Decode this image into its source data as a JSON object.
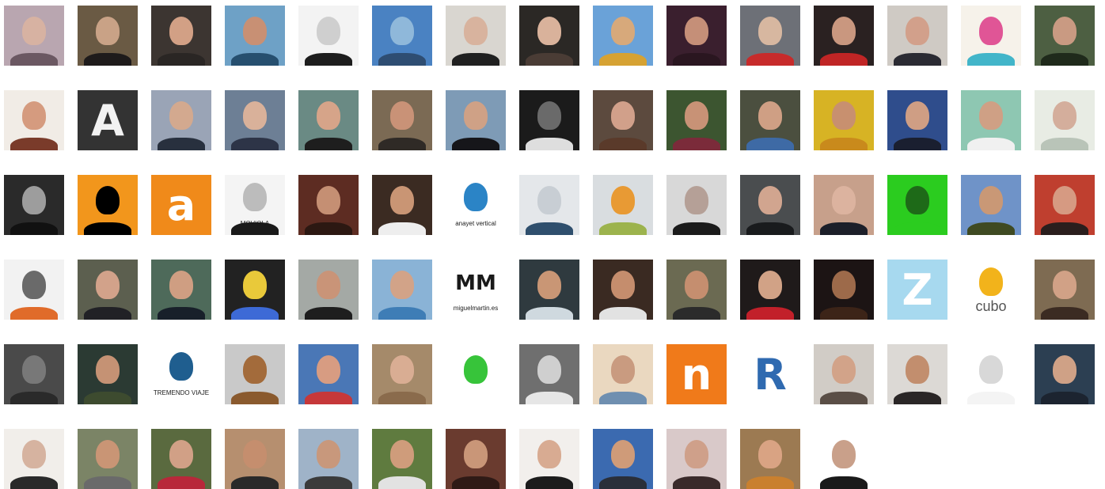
{
  "wall": {
    "rows": [
      {
        "items": [
          {
            "name": "woman-portrait",
            "bg": "#b9a6b0",
            "face": "#d7b2a2",
            "body": "#6b5862"
          },
          {
            "name": "man-glasses-portrait",
            "bg": "#6a5a44",
            "face": "#c9a286",
            "body": "#1e1b1b"
          },
          {
            "name": "smiling-man-portrait",
            "bg": "#3c3531",
            "face": "#d2a085",
            "body": "#2a2624"
          },
          {
            "name": "woman-sea-portrait",
            "bg": "#6ea1c6",
            "face": "#c89074",
            "body": "#264f6f"
          },
          {
            "name": "pixel-building-logo",
            "bg": "#f3f3f3",
            "face": "#cfcfcf",
            "body": "#1d1d1d"
          },
          {
            "name": "skyscraper-photo",
            "bg": "#4a82c2",
            "face": "#8fb8da",
            "body": "#2e4d72"
          },
          {
            "name": "bald-man-glasses-portrait",
            "bg": "#d9d6d0",
            "face": "#d8b39e",
            "body": "#202020"
          },
          {
            "name": "woman-glasses-portrait",
            "bg": "#2b2825",
            "face": "#d9b29b",
            "body": "#4a3c35"
          },
          {
            "name": "man-field-photo",
            "bg": "#6aa2d8",
            "face": "#d7a97b",
            "body": "#d6a233"
          },
          {
            "name": "woman-dark-portrait",
            "bg": "#3a1f2e",
            "face": "#c58f78",
            "body": "#2a1620"
          },
          {
            "name": "man-red-shirt-portrait",
            "bg": "#6d7077",
            "face": "#d7b7a0",
            "body": "#c72b2b"
          },
          {
            "name": "man-hat-cards-portrait",
            "bg": "#2a2121",
            "face": "#c9977f",
            "body": "#c02525"
          },
          {
            "name": "man-suit-tie-portrait",
            "bg": "#cfcac4",
            "face": "#d2a08b",
            "body": "#2b2b33"
          },
          {
            "name": "colorful-circle-logo",
            "bg": "#f6f2ea",
            "face": "#e05596",
            "body": "#42b5c9"
          },
          {
            "name": "man-outdoor-portrait",
            "bg": "#4d5f42",
            "face": "#c99a82",
            "body": "#1f2a1b"
          }
        ]
      },
      {
        "items": [
          {
            "name": "woman-red-hair-portrait",
            "bg": "#f1ece6",
            "face": "#d59b7f",
            "body": "#7a3b2a"
          },
          {
            "name": "letter-a-logo",
            "bg": "#333333",
            "face": "#555555",
            "body": "#222222",
            "glyph": "A",
            "glyphColor": "#f2f2f2"
          },
          {
            "name": "man-thinking-portrait",
            "bg": "#9aa4b6",
            "face": "#d3a98f",
            "body": "#28303e"
          },
          {
            "name": "man-suit-glasses-portrait",
            "bg": "#6d7f95",
            "face": "#d9b19a",
            "body": "#2d3447"
          },
          {
            "name": "woman-dark-hair-portrait",
            "bg": "#6a8a84",
            "face": "#d6a489",
            "body": "#1e1e1e"
          },
          {
            "name": "woman-smiling-portrait",
            "bg": "#7b6a54",
            "face": "#c99277",
            "body": "#2f2a26"
          },
          {
            "name": "man-poster-portrait",
            "bg": "#7e9bb6",
            "face": "#cfa186",
            "body": "#16161a"
          },
          {
            "name": "pixel-dark-logo",
            "bg": "#1b1b1b",
            "face": "#6a6a6a",
            "body": "#dedede"
          },
          {
            "name": "woman-curly-hair-portrait",
            "bg": "#5c4a3e",
            "face": "#d1a08a",
            "body": "#5a3a2a"
          },
          {
            "name": "woman-laughing-portrait",
            "bg": "#3c5530",
            "face": "#c89276",
            "body": "#7b2b3a"
          },
          {
            "name": "man-blue-shirt-portrait",
            "bg": "#4b4f3f",
            "face": "#cf9f84",
            "body": "#3e6aa5"
          },
          {
            "name": "man-yellow-bg-portrait",
            "bg": "#d7b324",
            "face": "#c8906f",
            "body": "#c98a1c"
          },
          {
            "name": "man-blue-stage-portrait",
            "bg": "#2f4d8c",
            "face": "#cf9e84",
            "body": "#1a1f30"
          },
          {
            "name": "man-green-bg-portrait",
            "bg": "#8ec7b2",
            "face": "#cfa085",
            "body": "#f0f0f0"
          },
          {
            "name": "woman-pale-portrait",
            "bg": "#e8ece4",
            "face": "#d4ae9c",
            "body": "#b9c4b8"
          }
        ]
      },
      {
        "items": [
          {
            "name": "bearded-man-stone-portrait",
            "bg": "#2a2a2a",
            "face": "#9d9d9d",
            "body": "#111111"
          },
          {
            "name": "orange-torn-logo",
            "bg": "#f2961c",
            "face": "#000000",
            "body": "#000000"
          },
          {
            "name": "letter-a-orange-logo",
            "bg": "#f08a1a",
            "face": "#f2e7d8",
            "body": "#23303e",
            "glyph": "a",
            "glyphColor": "#ffffff"
          },
          {
            "name": "moviola-logo",
            "bg": "#f4f4f4",
            "face": "#bcbcbc",
            "body": "#1a1a1a",
            "caption": "MOVIOLA"
          },
          {
            "name": "man-long-hair-portrait",
            "bg": "#5d2c22",
            "face": "#c58f73",
            "body": "#2c1812"
          },
          {
            "name": "man-white-shirt-portrait",
            "bg": "#3b2b22",
            "face": "#c99574",
            "body": "#eeeeee"
          },
          {
            "name": "mountain-logo",
            "bg": "#ffffff",
            "face": "#2b84c6",
            "body": "#ffffff",
            "caption": "anayet vertical"
          },
          {
            "name": "signature-card-photo",
            "bg": "#e4e7ea",
            "face": "#c8ced4",
            "body": "#2f4f6d"
          },
          {
            "name": "fruit-photo",
            "bg": "#d9dde0",
            "face": "#e89a34",
            "body": "#9cb34d"
          },
          {
            "name": "bald-man-sunglasses-portrait",
            "bg": "#d8d8d8",
            "face": "#b5a097",
            "body": "#1b1b1b"
          },
          {
            "name": "man-black-jacket-portrait",
            "bg": "#4a4d4f",
            "face": "#d1a58f",
            "body": "#191b1d"
          },
          {
            "name": "blonde-woman-portrait",
            "bg": "#c7a08b",
            "face": "#dcb39f",
            "body": "#1c1f29"
          },
          {
            "name": "green-figure-logo",
            "bg": "#2bcc1f",
            "face": "#1e6a18",
            "body": "#2bcc1f"
          },
          {
            "name": "man-bald-outdoor-portrait",
            "bg": "#6f93c8",
            "face": "#c99876",
            "body": "#3f4a22"
          },
          {
            "name": "woman-smile-portrait",
            "bg": "#bf3f2f",
            "face": "#d69a82",
            "body": "#2a1e1d"
          }
        ]
      },
      {
        "items": [
          {
            "name": "man-fedora-logo",
            "bg": "#f2f2f2",
            "face": "#6a6a6a",
            "body": "#e06b2a"
          },
          {
            "name": "woman-earrings-portrait",
            "bg": "#5c5f4f",
            "face": "#d2a28a",
            "body": "#212126"
          },
          {
            "name": "man-profile-portrait",
            "bg": "#4e6a5a",
            "face": "#cf9e82",
            "body": "#18202a"
          },
          {
            "name": "test-card-logo",
            "bg": "#222222",
            "face": "#e9c93a",
            "body": "#3d6ad6"
          },
          {
            "name": "man-black-shirt-portrait",
            "bg": "#a4a9a5",
            "face": "#c99478",
            "body": "#1e1e1e"
          },
          {
            "name": "bald-man-blue-shirt-portrait",
            "bg": "#8ab3d6",
            "face": "#d2a388",
            "body": "#3e7db6"
          },
          {
            "name": "miguel-martin-logo",
            "bg": "#ffffff",
            "face": "#ffffff",
            "body": "#ffffff",
            "glyph": "MM",
            "glyphColor": "#1a1a1a",
            "caption": "miguelmartin.es"
          },
          {
            "name": "man-t-shirt-portrait",
            "bg": "#2f3a3f",
            "face": "#c99675",
            "body": "#cfd9df"
          },
          {
            "name": "man-white-shirt-night-portrait",
            "bg": "#3a2a22",
            "face": "#c58d6d",
            "body": "#e2e2e2"
          },
          {
            "name": "man-cap-portrait",
            "bg": "#6b6a52",
            "face": "#c58e6f",
            "body": "#2b2b2b"
          },
          {
            "name": "man-sunglasses-red-portrait",
            "bg": "#1f1a1a",
            "face": "#d1a286",
            "body": "#c2202a"
          },
          {
            "name": "man-aviator-portrait",
            "bg": "#1c1414",
            "face": "#9d6a4a",
            "body": "#3c2418"
          },
          {
            "name": "letter-z-logo",
            "bg": "#a7d9ef",
            "face": "#ffffff",
            "body": "#a7d9ef",
            "glyph": "Z",
            "glyphColor": "#ffffff"
          },
          {
            "name": "cubo-logo",
            "bg": "#ffffff",
            "face": "#f2b31b",
            "body": "#ffffff",
            "caption": "cubo"
          },
          {
            "name": "woman-brown-hair-portrait",
            "bg": "#7e6b52",
            "face": "#d1a186",
            "body": "#3b2b22"
          }
        ]
      },
      {
        "items": [
          {
            "name": "pixel-stripes-logo",
            "bg": "#4a4a4a",
            "face": "#787878",
            "body": "#2a2a2a"
          },
          {
            "name": "bearded-man-sign-portrait",
            "bg": "#2b3a33",
            "face": "#c59274",
            "body": "#3d4b2f"
          },
          {
            "name": "tremendo-viaje-logo",
            "bg": "#ffffff",
            "face": "#1f5e8f",
            "body": "#ffffff",
            "caption": "TREMENDO VIAJE"
          },
          {
            "name": "wookiee-toy-photo",
            "bg": "#c9c9c9",
            "face": "#a36b3b",
            "body": "#8a5a2e"
          },
          {
            "name": "woman-hat-sunglasses-portrait",
            "bg": "#4a77b6",
            "face": "#d79c82",
            "body": "#c6383a"
          },
          {
            "name": "blonde-woman-hand-portrait",
            "bg": "#a58a6a",
            "face": "#d9ad93",
            "body": "#8a6b4c"
          },
          {
            "name": "green-circle-logo",
            "bg": "#ffffff",
            "face": "#37c43a",
            "body": "#ffffff"
          },
          {
            "name": "child-bw-photo",
            "bg": "#6f6f6f",
            "face": "#cfcfcf",
            "body": "#e6e6e6"
          },
          {
            "name": "man-framed-photo",
            "bg": "#ead8c0",
            "face": "#c99b80",
            "body": "#6f8fb0"
          },
          {
            "name": "letter-n-orange-logo",
            "bg": "#f07a1a",
            "face": "#ffffff",
            "body": "#f07a1a",
            "glyph": "n",
            "glyphColor": "#ffffff"
          },
          {
            "name": "letter-r-blue-logo",
            "bg": "#ffffff",
            "face": "#2f6ab0",
            "body": "#ffffff",
            "glyph": "R",
            "glyphColor": "#2f6ab0"
          },
          {
            "name": "man-white-beard-portrait",
            "bg": "#d1ccc6",
            "face": "#d2a389",
            "body": "#5a4e46"
          },
          {
            "name": "man-panama-hat-portrait",
            "bg": "#dcd9d5",
            "face": "#c28e6e",
            "body": "#2a2626"
          },
          {
            "name": "pixel-light-logo",
            "bg": "#ffffff",
            "face": "#d8d8d8",
            "body": "#f4f4f4"
          },
          {
            "name": "man-dark-hair-portrait",
            "bg": "#2c3f52",
            "face": "#cfa186",
            "body": "#1c2430"
          }
        ]
      },
      {
        "items": [
          {
            "name": "bald-man-glasses-white-portrait",
            "bg": "#f1eeea",
            "face": "#d6b3a0",
            "body": "#2a2a2a"
          },
          {
            "name": "man-cap-outdoor-portrait",
            "bg": "#7b8466",
            "face": "#c99575",
            "body": "#6a6a6a"
          },
          {
            "name": "woman-red-top-portrait",
            "bg": "#5a6a3f",
            "face": "#d1a086",
            "body": "#b8283a"
          },
          {
            "name": "man-camera-portrait",
            "bg": "#b68f6f",
            "face": "#c58e6e",
            "body": "#2a2a2a"
          },
          {
            "name": "man-river-portrait",
            "bg": "#9fb3c8",
            "face": "#c8987c",
            "body": "#3b3b3b"
          },
          {
            "name": "man-sports-photo",
            "bg": "#5f7b3f",
            "face": "#cf9c7b",
            "body": "#e2e2e2"
          },
          {
            "name": "man-window-portrait",
            "bg": "#6a3b2f",
            "face": "#c99678",
            "body": "#2f1a16"
          },
          {
            "name": "woman-long-hair-portrait",
            "bg": "#f2efec",
            "face": "#d8ab92",
            "body": "#1c1c1c"
          },
          {
            "name": "man-blue-cap-portrait",
            "bg": "#3b6ab0",
            "face": "#cf9b79",
            "body": "#2a2f3a"
          },
          {
            "name": "man-badge-portrait",
            "bg": "#d9c9c9",
            "face": "#cfa08a",
            "body": "#3a2a2a"
          },
          {
            "name": "man-red-hair-portrait",
            "bg": "#9c7a52",
            "face": "#d9a383",
            "body": "#c9802f"
          },
          {
            "name": "man-standing-silhouette",
            "bg": "#ffffff",
            "face": "#c9a08a",
            "body": "#1a1a1a"
          }
        ]
      }
    ]
  }
}
